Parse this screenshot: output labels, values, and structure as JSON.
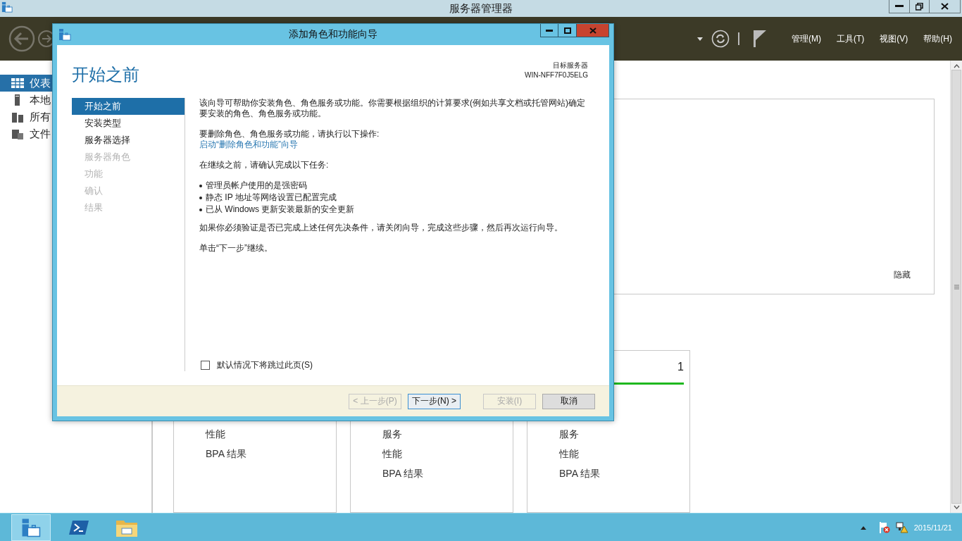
{
  "window": {
    "title": "服务器管理器"
  },
  "toolbar": {
    "menus": [
      "管理(M)",
      "工具(T)",
      "视图(V)",
      "帮助(H)"
    ]
  },
  "sidebar": {
    "items": [
      {
        "label": "仪表",
        "selected": true
      },
      {
        "label": "本地",
        "selected": false
      },
      {
        "label": "所有",
        "selected": false
      },
      {
        "label": "文件",
        "selected": false
      }
    ]
  },
  "welcome_panel": {
    "hide_link": "隐藏"
  },
  "tiles": [
    {
      "rows": [
        "性能",
        "BPA 结果"
      ]
    },
    {
      "rows": [
        "服务",
        "性能",
        "BPA 结果"
      ]
    },
    {
      "count": "1",
      "color": "#1fb81f",
      "rows": [
        "服务",
        "性能",
        "BPA 结果"
      ]
    }
  ],
  "dialog": {
    "title": "添加角色和功能向导",
    "heading": "开始之前",
    "target_label": "目标服务器",
    "target_server": "WIN-NFF7F0J5ELG",
    "steps": [
      {
        "label": "开始之前",
        "selected": true,
        "disabled": false
      },
      {
        "label": "安装类型",
        "selected": false,
        "disabled": false
      },
      {
        "label": "服务器选择",
        "selected": false,
        "disabled": false
      },
      {
        "label": "服务器角色",
        "selected": false,
        "disabled": true
      },
      {
        "label": "功能",
        "selected": false,
        "disabled": true
      },
      {
        "label": "确认",
        "selected": false,
        "disabled": true
      },
      {
        "label": "结果",
        "selected": false,
        "disabled": true
      }
    ],
    "content": [
      {
        "kind": "paragraph",
        "text": "该向导可帮助你安装角色、角色服务或功能。你需要根据组织的计算要求(例如共享文档或托管网站)确定要安装的角色、角色服务或功能。"
      },
      {
        "kind": "paragraph",
        "text": "要删除角色、角色服务或功能，请执行以下操作:"
      },
      {
        "kind": "link",
        "text": "启动“删除角色和功能”向导"
      },
      {
        "kind": "paragraph",
        "text": "在继续之前，请确认完成以下任务:"
      },
      {
        "kind": "bullets",
        "items": [
          "管理员帐户使用的是强密码",
          "静态 IP 地址等网络设置已配置完成",
          "已从 Windows 更新安装最新的安全更新"
        ]
      },
      {
        "kind": "paragraph",
        "text": "如果你必须验证是否已完成上述任何先决条件，请关闭向导，完成这些步骤，然后再次运行向导。"
      },
      {
        "kind": "paragraph",
        "text": "单击“下一步”继续。"
      }
    ],
    "skip_checkbox": {
      "label": "默认情况下将跳过此页(S)",
      "checked": false
    },
    "buttons": [
      {
        "label": "< 上一步(P)",
        "disabled": true,
        "kind": "nav"
      },
      {
        "label": "下一步(N) >",
        "disabled": false,
        "kind": "default"
      },
      {
        "label": "安装(I)",
        "disabled": true,
        "kind": "action"
      },
      {
        "label": "取消",
        "disabled": false,
        "kind": "cancel"
      }
    ]
  },
  "taskbar": {
    "apps": [
      {
        "kind": "server-manager",
        "selected": true
      },
      {
        "kind": "powershell",
        "selected": false
      },
      {
        "kind": "explorer",
        "selected": false
      }
    ],
    "date": "2015/11/21"
  }
}
